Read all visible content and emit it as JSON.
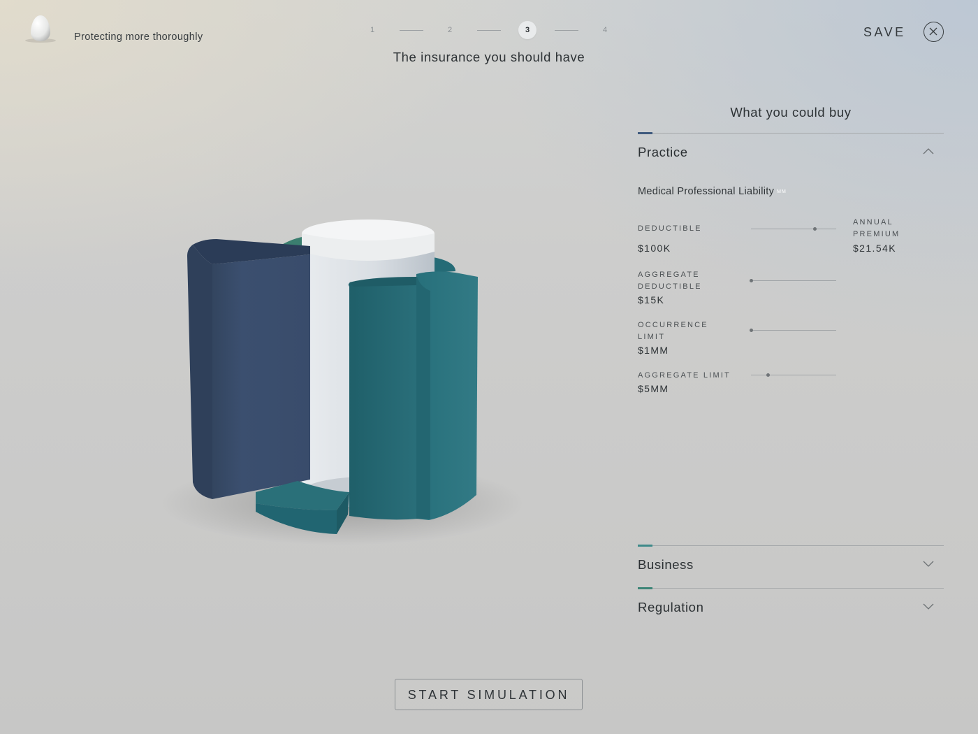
{
  "header": {
    "tagline": "Protecting more thoroughly",
    "title": "The insurance you should have",
    "save_label": "SAVE"
  },
  "stepper": {
    "steps": [
      "1",
      "2",
      "3",
      "4"
    ],
    "active_step": 3
  },
  "panel": {
    "title": "What you could buy",
    "sections": [
      {
        "label": "Practice",
        "expanded": true,
        "accent_color": "#3f5a7e"
      },
      {
        "label": "Business",
        "expanded": false,
        "accent_color": "#3e8a8a"
      },
      {
        "label": "Regulation",
        "expanded": false,
        "accent_color": "#3d8577"
      }
    ],
    "coverage": {
      "name": "Medical Professional Liability",
      "badge": "MM",
      "deductible": {
        "label": "DEDUCTIBLE",
        "value": "$100K",
        "level": 0.75
      },
      "annual_premium": {
        "label": "ANNUAL PREMIUM",
        "value": "$21.54K"
      },
      "aggregate_deductible": {
        "label": "AGGREGATE DEDUCTIBLE",
        "value": "$15K",
        "level": 0
      },
      "occurrence_limit": {
        "label": "OCCURRENCE LIMIT",
        "value": "$1MM",
        "level": 0
      },
      "aggregate_limit": {
        "label": "AGGREGATE LIMIT",
        "value": "$5MM",
        "level": 0.2
      }
    }
  },
  "actions": {
    "start_label": "START SIMULATION"
  },
  "colors": {
    "navy_segment": "#394c6b",
    "teal_segment": "#226470",
    "core": "#dfe3e7"
  }
}
